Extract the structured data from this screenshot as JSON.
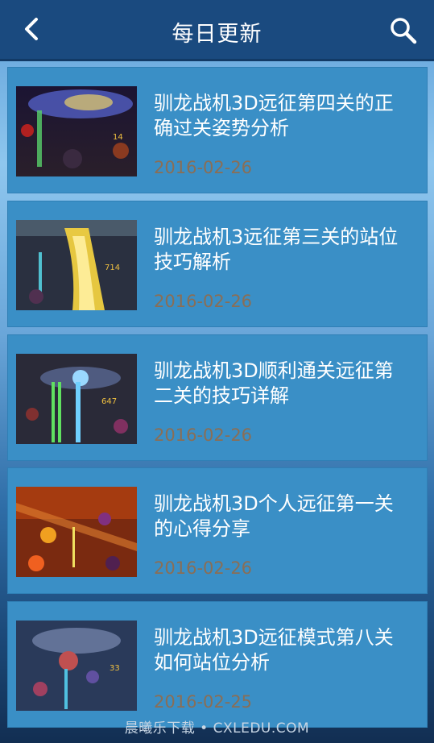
{
  "header": {
    "title": "每日更新",
    "back_icon": "chevron-left-icon",
    "search_icon": "search-icon"
  },
  "articles": [
    {
      "title": "驯龙战机3D远征第四关的正确过关姿势分析",
      "date": "2016-02-26"
    },
    {
      "title": "驯龙战机3远征第三关的站位技巧解析",
      "date": "2016-02-26"
    },
    {
      "title": "驯龙战机3D顺利通关远征第二关的技巧详解",
      "date": "2016-02-26"
    },
    {
      "title": "驯龙战机3D个人远征第一关的心得分享",
      "date": "2016-02-26"
    },
    {
      "title": "驯龙战机3D远征模式第八关如何站位分析",
      "date": "2016-02-25"
    }
  ],
  "thumb_overlays": [
    "14",
    "714",
    "647",
    "",
    "33"
  ],
  "watermark": "晨曦乐下载 • CXLEDU.COM",
  "colors": {
    "header": "#1a4a7f",
    "card": "#3a8fc6",
    "date": "#8a6e55"
  }
}
